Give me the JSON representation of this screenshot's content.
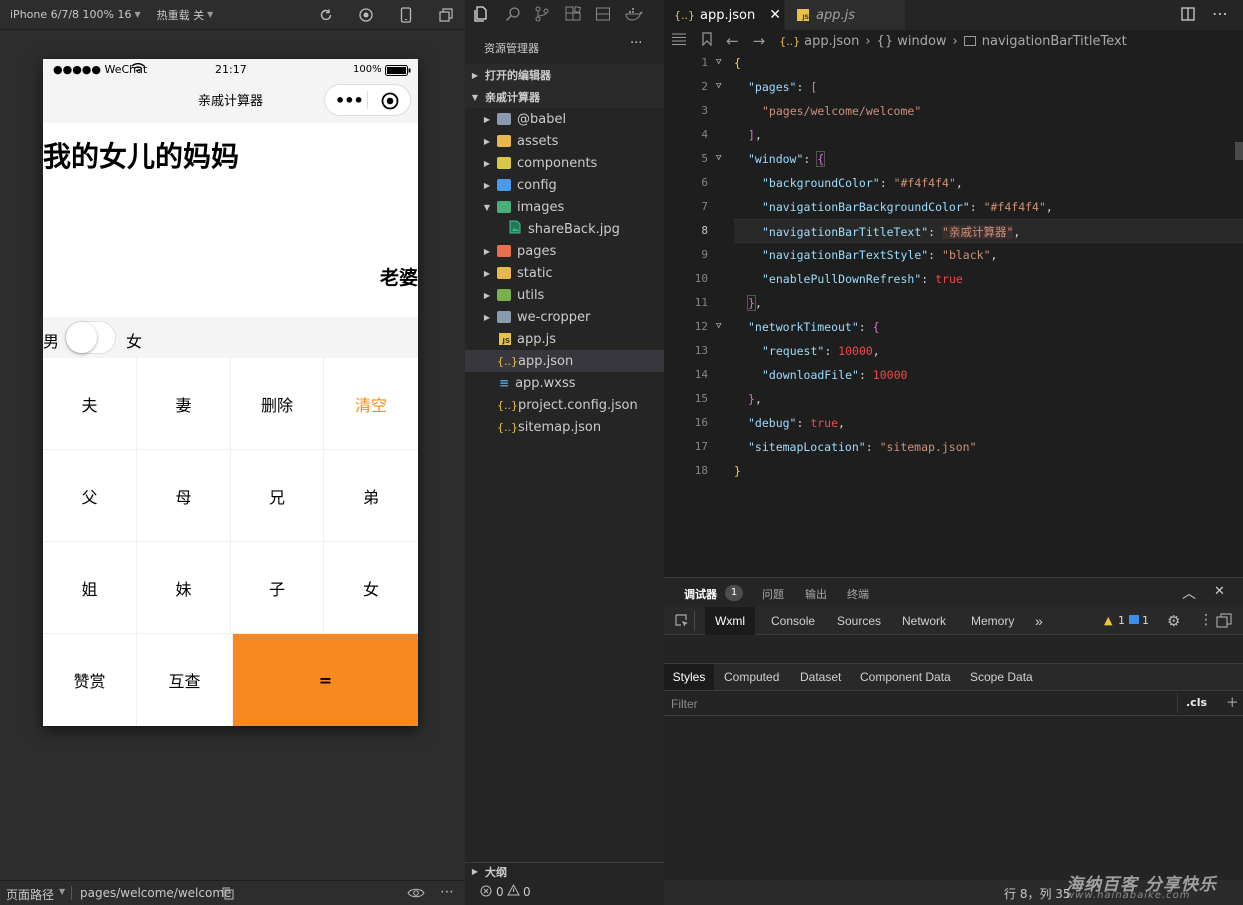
{
  "sim_toolbar": {
    "device": "iPhone 6/7/8 100% 16",
    "hot_reload": "热重载 关"
  },
  "phone": {
    "status": {
      "carrier": "●●●●● WeChat",
      "time": "21:17",
      "battery": "100%"
    },
    "nav_title": "亲戚计算器",
    "expression": "我的女儿的妈妈",
    "answer": "老婆",
    "gender": {
      "male": "男",
      "female": "女",
      "toggle_on": false
    },
    "keys": [
      [
        "夫",
        "妻",
        "删除",
        "清空"
      ],
      [
        "父",
        "母",
        "兄",
        "弟"
      ],
      [
        "姐",
        "妹",
        "子",
        "女"
      ],
      [
        "赞赏",
        "互查",
        "="
      ]
    ],
    "colors": {
      "accent": "#f6891f",
      "clear_text": "#f18c1f"
    }
  },
  "explorer": {
    "title": "资源管理器",
    "more": "···",
    "open_editors": "打开的编辑器",
    "project": "亲戚计算器",
    "items": [
      {
        "name": "@babel",
        "type": "folder",
        "color": "#8a9bb0"
      },
      {
        "name": "assets",
        "type": "folder",
        "color": "#e8b84a"
      },
      {
        "name": "components",
        "type": "folder",
        "color": "#d9c74a"
      },
      {
        "name": "config",
        "type": "folder",
        "color": "#4a9be8"
      },
      {
        "name": "images",
        "type": "folder-open",
        "color": "#4ab07a"
      },
      {
        "name": "shareBack.jpg",
        "type": "image"
      },
      {
        "name": "pages",
        "type": "folder",
        "color": "#e8704a"
      },
      {
        "name": "static",
        "type": "folder",
        "color": "#e8b84a"
      },
      {
        "name": "utils",
        "type": "folder",
        "color": "#7ab04a"
      },
      {
        "name": "we-cropper",
        "type": "folder",
        "color": "#8a9bb0"
      },
      {
        "name": "app.js",
        "type": "js"
      },
      {
        "name": "app.json",
        "type": "json"
      },
      {
        "name": "app.wxss",
        "type": "css"
      },
      {
        "name": "project.config.json",
        "type": "json"
      },
      {
        "name": "sitemap.json",
        "type": "json"
      }
    ],
    "outline": "大纲"
  },
  "editor": {
    "tabs": [
      {
        "label": "app.json",
        "icon": "{..}",
        "active": true
      },
      {
        "label": "app.js",
        "icon": "JS",
        "active": false
      }
    ],
    "breadcrumb": {
      "file": "app.json",
      "obj": "{} window",
      "prop": "navigationBarTitleText"
    },
    "lines": [
      "1",
      "2",
      "3",
      "4",
      "5",
      "6",
      "7",
      "8",
      "9",
      "10",
      "11",
      "12",
      "13",
      "14",
      "15",
      "16",
      "17",
      "18"
    ],
    "code": {
      "pages_key": "\"pages\"",
      "pages_val": "\"pages/welcome/welcome\"",
      "window_key": "\"window\"",
      "bg_key": "\"backgroundColor\"",
      "bg_val": "\"#f4f4f4\"",
      "navbg_key": "\"navigationBarBackgroundColor\"",
      "navbg_val": "\"#f4f4f4\"",
      "title_key": "\"navigationBarTitleText\"",
      "title_val": "\"亲戚计算器\"",
      "textstyle_key": "\"navigationBarTextStyle\"",
      "textstyle_val": "\"black\"",
      "refresh_key": "\"enablePullDownRefresh\"",
      "refresh_val": "true",
      "timeout_key": "\"networkTimeout\"",
      "request_key": "\"request\"",
      "request_val": "10000",
      "download_key": "\"downloadFile\"",
      "download_val": "10000",
      "debug_key": "\"debug\"",
      "debug_val": "true",
      "sitemap_key": "\"sitemapLocation\"",
      "sitemap_val": "\"sitemap.json\""
    }
  },
  "debugger": {
    "tabs": [
      {
        "label": "调试器",
        "badge": "1"
      },
      {
        "label": "问题"
      },
      {
        "label": "输出"
      },
      {
        "label": "终端"
      }
    ],
    "panels": [
      "Wxml",
      "Console",
      "Sources",
      "Network",
      "Memory"
    ],
    "more": "»",
    "warn_count": "1",
    "info_count": "1",
    "style_tabs": [
      "Styles",
      "Computed",
      "Dataset",
      "Component Data",
      "Scope Data"
    ],
    "filter_placeholder": "Filter",
    "cls": ".cls",
    "plus": "+"
  },
  "status": {
    "path_label": "页面路径",
    "path_value": "pages/welcome/welcome",
    "errors": "0",
    "warnings": "0",
    "cursor": "行 8，列 35",
    "watermark": "海纳百客 分享快乐",
    "watermark_url": "www.hainabaike.com"
  }
}
